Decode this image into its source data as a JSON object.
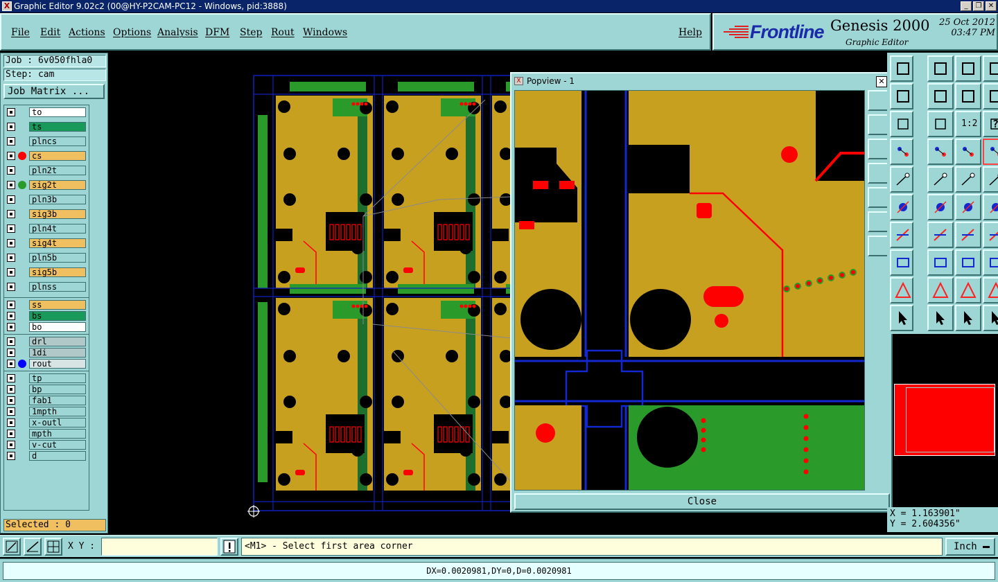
{
  "window": {
    "title": "Graphic Editor 9.02c2 (00@HY-P2CAM-PC12 - Windows, pid:3888)"
  },
  "menu": {
    "file": "File",
    "edit": "Edit",
    "actions": "Actions",
    "options": "Options",
    "analysis": "Analysis",
    "dfm": "DFM",
    "step": "Step",
    "rout": "Rout",
    "windows": "Windows",
    "help": "Help"
  },
  "brand": {
    "logo": "Frontline",
    "product": "Genesis 2000",
    "subtitle": "Graphic Editor",
    "date": "25 Oct 2012",
    "time": "03:47 PM"
  },
  "job": {
    "job_label": "Job : 6v050fhla0",
    "step_label": "Step: cam",
    "matrix_button": "Job Matrix ..."
  },
  "layers": [
    {
      "name": "to",
      "bg": "#ffffff",
      "dot": ""
    },
    {
      "name": "ts",
      "bg": "#1a9a5a",
      "dot": ""
    },
    {
      "name": "plncs",
      "bg": "#9ed6d6",
      "dot": ""
    },
    {
      "name": "cs",
      "bg": "#f0c060",
      "dot": "#ff0000"
    },
    {
      "name": "pln2t",
      "bg": "#9ed6d6",
      "dot": ""
    },
    {
      "name": "sig2t",
      "bg": "#f0c060",
      "dot": "#2a9a2a"
    },
    {
      "name": "pln3b",
      "bg": "#9ed6d6",
      "dot": ""
    },
    {
      "name": "sig3b",
      "bg": "#f0c060",
      "dot": ""
    },
    {
      "name": "pln4t",
      "bg": "#9ed6d6",
      "dot": ""
    },
    {
      "name": "sig4t",
      "bg": "#f0c060",
      "dot": ""
    },
    {
      "name": "pln5b",
      "bg": "#9ed6d6",
      "dot": ""
    },
    {
      "name": "sig5b",
      "bg": "#f0c060",
      "dot": ""
    },
    {
      "name": "plnss",
      "bg": "#9ed6d6",
      "dot": ""
    },
    {
      "name": "ss",
      "bg": "#f0c060",
      "dot": ""
    },
    {
      "name": "bs",
      "bg": "#1a9a5a",
      "dot": ""
    },
    {
      "name": "bo",
      "bg": "#ffffff",
      "dot": ""
    },
    {
      "name": "drl",
      "bg": "#b0c8c8",
      "dot": ""
    },
    {
      "name": "1di",
      "bg": "#b0c8c8",
      "dot": ""
    },
    {
      "name": "rout",
      "bg": "#d8e4e4",
      "dot": "#0000ff"
    },
    {
      "name": "tp",
      "bg": "#9ed6d6",
      "dot": ""
    },
    {
      "name": "bp",
      "bg": "#9ed6d6",
      "dot": ""
    },
    {
      "name": "fab1",
      "bg": "#9ed6d6",
      "dot": ""
    },
    {
      "name": "1mpth",
      "bg": "#9ed6d6",
      "dot": ""
    },
    {
      "name": "x-outl",
      "bg": "#9ed6d6",
      "dot": ""
    },
    {
      "name": "mpth",
      "bg": "#9ed6d6",
      "dot": ""
    },
    {
      "name": "v-cut",
      "bg": "#9ed6d6",
      "dot": ""
    },
    {
      "name": "d",
      "bg": "#9ed6d6",
      "dot": ""
    }
  ],
  "selected": "Selected : 0",
  "popview": {
    "title": "Popview - 1",
    "close_button": "Close"
  },
  "tools": {
    "ratio_label": "1:2",
    "help_glyph": "?"
  },
  "coords": {
    "x": "X = 1.163901\"",
    "y": "Y = 2.604356\""
  },
  "command": {
    "xy_label": "X Y :",
    "xy_value": "",
    "prompt": "<M1> - Select first area corner",
    "unit": "Inch"
  },
  "status": "DX=0.0020981,DY=0,D=0.0020981",
  "colors": {
    "panel": "#9ed6d6",
    "copper": "#c8a020",
    "mask": "#2a9a2a",
    "pad": "#ff0000",
    "rout": "#0000ff"
  }
}
